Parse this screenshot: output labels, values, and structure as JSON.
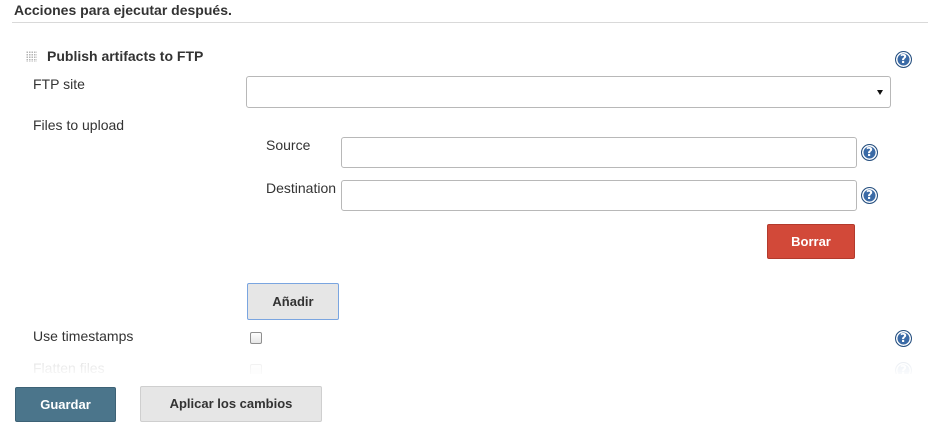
{
  "section": {
    "title": "Acciones para ejecutar después."
  },
  "publisher": {
    "title": "Publish artifacts to FTP",
    "help_glyph": "?",
    "ftp_site": {
      "label": "FTP site",
      "selected_value": ""
    },
    "files_to_upload": {
      "label": "Files to upload",
      "source": {
        "label": "Source",
        "value": ""
      },
      "destination": {
        "label": "Destination",
        "value": ""
      },
      "delete_label": "Borrar"
    },
    "add_label": "Añadir",
    "use_timestamps": {
      "label": "Use timestamps",
      "checked": false
    },
    "flatten_files": {
      "label": "Flatten files",
      "checked": false
    }
  },
  "footer": {
    "save_label": "Guardar",
    "apply_label": "Aplicar los cambios"
  },
  "colors": {
    "help_icon": "#3a6aa6",
    "delete_button": "#d24939",
    "save_button": "#4b758b",
    "neutral_button": "#e6e6e6",
    "add_button_border": "#7aa5e0"
  },
  "icons": {
    "help": "help-icon",
    "drag": "drag-handle-icon",
    "select_arrow": "chevron-down-icon"
  }
}
